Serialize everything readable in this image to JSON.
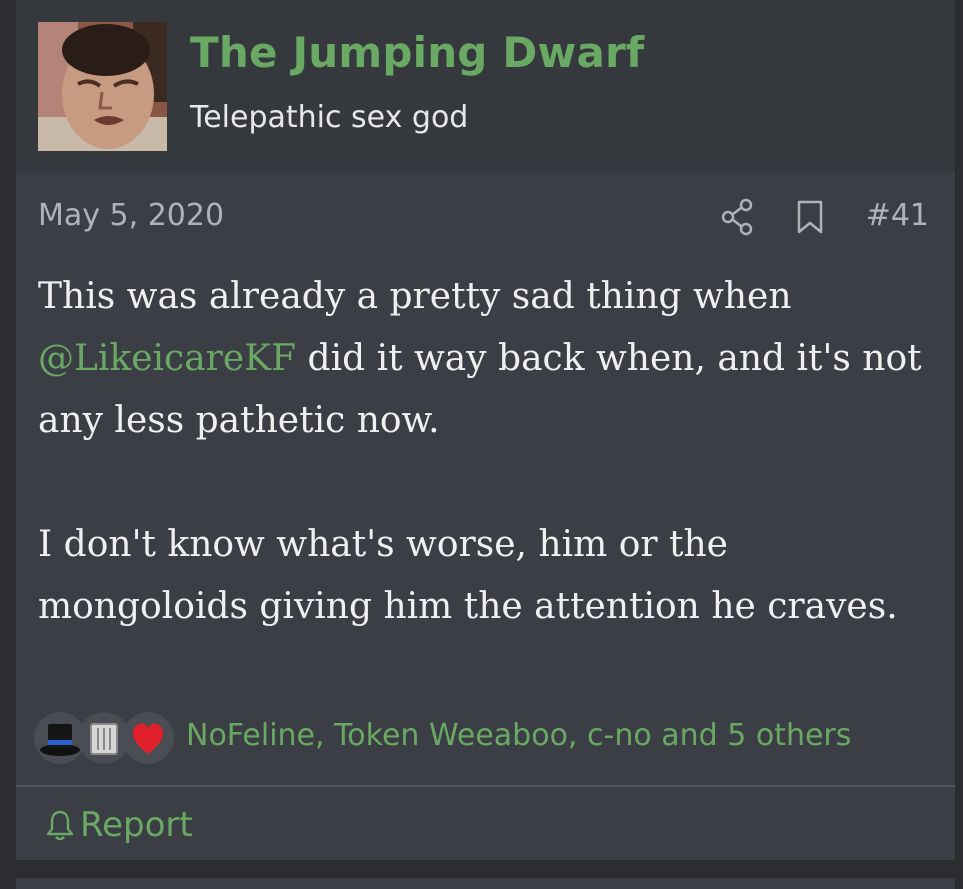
{
  "post": {
    "author": {
      "username": "The Jumping Dwarf",
      "title": "Telepathic sex god",
      "avatar_icon": "user-avatar-photo"
    },
    "date": "May 5, 2020",
    "number": "#41",
    "actions": {
      "share_icon": "share-icon",
      "bookmark_icon": "bookmark-icon"
    },
    "body": {
      "line1_before": "This was already a pretty sad thing when ",
      "mention": "@LikeicareKF",
      "line1_after": " did it way back when, and it's not any less pathetic now.",
      "paragraph2": "I don't know what's worse, him or the mongoloids giving him the attention he craves."
    },
    "reactions": {
      "icons": [
        "top-hat-icon",
        "trash-can-icon",
        "heart-icon"
      ],
      "summary": "NoFeline, Token Weeaboo, c-no and 5 others"
    },
    "footer": {
      "report_label": "Report",
      "report_icon": "bell-icon"
    }
  },
  "colors": {
    "accent_green": "#6aa963",
    "post_background": "#3b3e44",
    "header_background": "#35383d",
    "page_background": "#2b2d31",
    "body_text": "#f0f0f0",
    "muted_text": "#b0b2b6"
  }
}
